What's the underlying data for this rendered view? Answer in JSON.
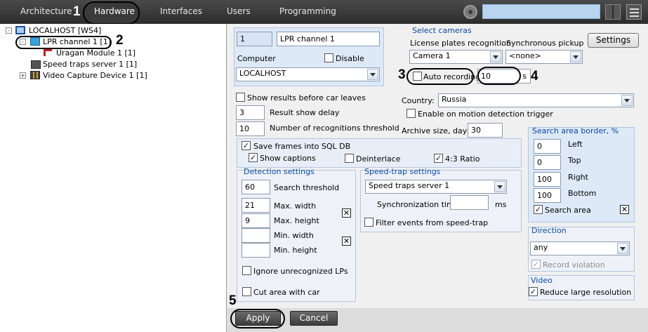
{
  "top_tabs": [
    "Architecture",
    "Hardware",
    "Interfaces",
    "Users",
    "Programming"
  ],
  "callouts": [
    "1",
    "2",
    "3",
    "4",
    "5"
  ],
  "tree": [
    {
      "label": "LOCALHOST [WS4]",
      "expander": "-"
    },
    {
      "label": "LPR channel 1 [1]",
      "expander": "-"
    },
    {
      "label": "Uragan Module 1 [1]"
    },
    {
      "label": "Speed traps server 1 [1]"
    },
    {
      "label": "Video Capture Device 1 [1]",
      "expander": "+"
    }
  ],
  "general": {
    "id": "1",
    "name": "LPR channel 1",
    "computer_label": "Computer",
    "disable_label": "Disable",
    "computer_value": "LOCALHOST"
  },
  "select_cameras": {
    "title": "Select cameras",
    "plate_label": "License plates recognition",
    "plate_value": "Camera 1",
    "sync_label": "Synchronous pickup",
    "sync_value": "<none>",
    "settings_button": "Settings",
    "auto_recording": "Auto recording",
    "auto_value": "10",
    "auto_unit": "s"
  },
  "options": {
    "show_results": "Show results before car leaves",
    "delay_value": "3",
    "delay_label": "Result show delay",
    "recog_value": "10",
    "recog_label": "Number of recognitions threshold",
    "country_label": "Country:",
    "country_value": "Russia",
    "motion_trigger": "Enable on motion detection trigger",
    "archive_label": "Archive size, days:",
    "archive_value": "30",
    "save_frames": "Save frames into SQL DB",
    "show_captions": "Show captions",
    "deinterlace": "Deinterlace",
    "ratio": "4:3 Ratio"
  },
  "detection": {
    "title": "Detection settings",
    "threshold_value": "60",
    "threshold_label": "Search threshold",
    "max_width_value": "21",
    "max_width_label": "Max. width",
    "max_height_value": "9",
    "max_height_label": "Max. height",
    "min_width_value": "",
    "min_width_label": "Min. width",
    "min_height_value": "",
    "min_height_label": "Min. height",
    "ignore_lps": "Ignore unrecognized LPs",
    "cut_area": "Cut area with car"
  },
  "speedtrap": {
    "title": "Speed-trap settings",
    "server_value": "Speed traps server 1",
    "sync_label": "Synchronization time",
    "sync_value": "",
    "sync_unit": "ms",
    "filter_label": "Filter events from speed-trap"
  },
  "search_area": {
    "title": "Search area border, %",
    "left_value": "0",
    "left_label": "Left",
    "top_value": "0",
    "top_label": "Top",
    "right_value": "100",
    "right_label": "Right",
    "bottom_value": "100",
    "bottom_label": "Bottom",
    "search_area_label": "Search area"
  },
  "direction": {
    "title": "Direction",
    "value": "any",
    "record_violation": "Record violation"
  },
  "video": {
    "title": "Video",
    "reduce": "Reduce large resolution"
  },
  "actions": {
    "apply": "Apply",
    "cancel": "Cancel"
  },
  "colors": {
    "topbar": "#3a3a3a",
    "group_title": "#0b4aa0",
    "search_box": "#b8d4ef",
    "highlight_box": "#dde9f7"
  }
}
